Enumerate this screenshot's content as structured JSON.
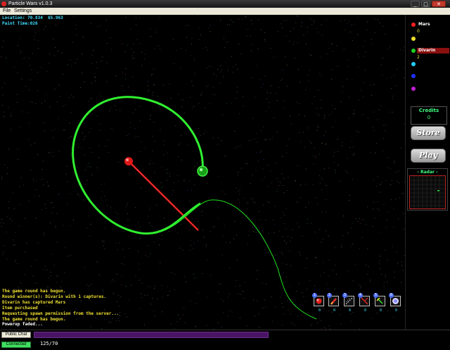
{
  "window": {
    "title": "Particle Wars v1.0.3",
    "min_glyph": "_",
    "max_glyph": "□",
    "close_glyph": "✕",
    "icon": "app-ball-icon"
  },
  "menu": [
    "File",
    "Settings"
  ],
  "hud": {
    "location_label": "Location:",
    "location_x": "70.834",
    "location_y": "65.963",
    "paint_time": "Paint Time:026"
  },
  "log": [
    "The game round has begun.",
    "Round winner(s): Divarin with 1 captures.",
    "Divarin has captured Mars",
    "Item purchased",
    "Requesting spawn permission from the server...",
    "The game round has begun.",
    "Powerup faded..."
  ],
  "toolbar": {
    "items": [
      {
        "num": "1",
        "count": "0",
        "icon": "red-orb-icon"
      },
      {
        "num": "2",
        "count": "0",
        "icon": "rocket-icon"
      },
      {
        "num": "3",
        "count": "0",
        "icon": "chain-icon"
      },
      {
        "num": "4",
        "count": "0",
        "icon": "laser-icon"
      },
      {
        "num": "5",
        "count": "0",
        "icon": "wand-icon"
      },
      {
        "num": "6",
        "count": "0",
        "icon": "shield-orb-icon"
      }
    ]
  },
  "players": [
    {
      "name": "Mars",
      "color": "#ff2020",
      "score": "0"
    },
    {
      "name": "",
      "color": "#f0e030",
      "score": ""
    },
    {
      "name": "Divarin",
      "color": "#20d020",
      "score": "2",
      "selected": true
    },
    {
      "name": "",
      "color": "#20d0ff",
      "score": ""
    },
    {
      "name": "",
      "color": "#2030ff",
      "score": ""
    },
    {
      "name": "",
      "color": "#c020d0",
      "score": ""
    }
  ],
  "credits": {
    "label": "Credits",
    "value": "0"
  },
  "buttons": {
    "store": "Store",
    "play": "Play"
  },
  "radar": {
    "label": "- Radar -"
  },
  "bottom": {
    "chat_label": "Public Chat",
    "chat_value": "",
    "connected_label": "Connected",
    "fps": "125/70"
  },
  "colors": {
    "accent_cyan": "#40e0ff",
    "log_yellow": "#f0e030",
    "player_green": "#20d020",
    "mars_red": "#ff2020"
  }
}
